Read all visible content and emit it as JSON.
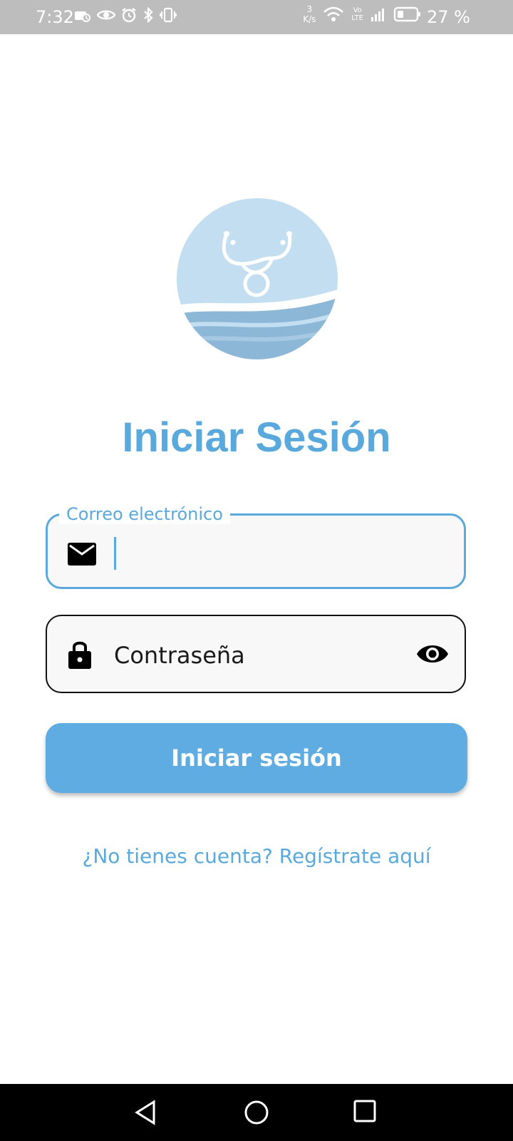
{
  "status_bar": {
    "time": "7:32",
    "speed_value": "3",
    "speed_unit": "K/s",
    "volte_top": "Vo",
    "volte_bottom": "LTE",
    "battery_percent": "27 %",
    "icons": [
      "cast-icon",
      "eye-icon",
      "alarm-icon",
      "bluetooth-icon",
      "vibrate-icon",
      "wifi-icon",
      "signal-icon",
      "battery-icon"
    ]
  },
  "login": {
    "title": "Iniciar Sesión",
    "email_label": "Correo electrónico",
    "email_value": "",
    "password_placeholder": "Contraseña",
    "submit_label": "Iniciar sesión",
    "register_link": "¿No tienes cuenta? Regístrate aquí"
  },
  "colors": {
    "accent": "#5aa9dc",
    "button": "#5eace1",
    "logo_bg": "#c2def0"
  },
  "nav_bar": {
    "buttons": [
      "back-icon",
      "home-icon",
      "recents-icon"
    ]
  }
}
